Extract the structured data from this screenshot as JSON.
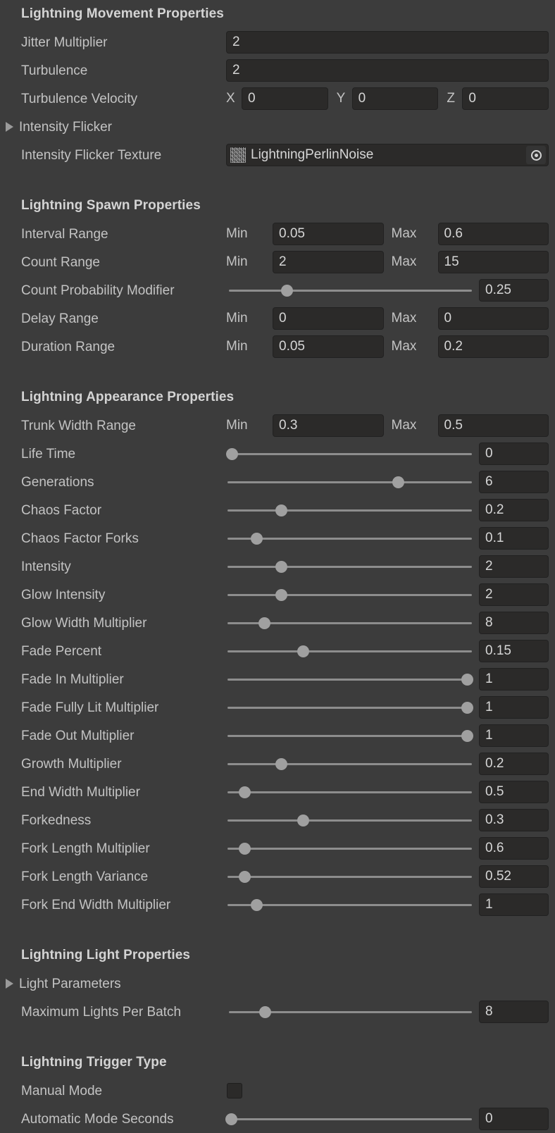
{
  "colors": {
    "background": "#3c3c3c",
    "field_fill": "#2b2a29",
    "field_border": "#212121",
    "label_text": "#c3c3c3",
    "header_text": "#d4d4d4",
    "value_text": "#d6d6d6",
    "slider_track": "#8d8d8d",
    "slider_handle": "#a0a0a0"
  },
  "sections": {
    "movement": {
      "title": "Lightning Movement Properties",
      "jitter_multiplier": {
        "label": "Jitter Multiplier",
        "value": "2"
      },
      "turbulence": {
        "label": "Turbulence",
        "value": "2"
      },
      "turbulence_velocity": {
        "label": "Turbulence Velocity",
        "x_label": "X",
        "x_value": "0",
        "y_label": "Y",
        "y_value": "0",
        "z_label": "Z",
        "z_value": "0"
      },
      "intensity_flicker": {
        "label": "Intensity Flicker",
        "expanded": false
      },
      "intensity_flicker_texture": {
        "label": "Intensity Flicker Texture",
        "value": "LightningPerlinNoise",
        "thumbnail": "noise-texture-thumbnail",
        "picker": "object-picker-icon"
      }
    },
    "spawn": {
      "title": "Lightning Spawn Properties",
      "min_label": "Min",
      "max_label": "Max",
      "rows": [
        {
          "label": "Interval Range",
          "min": "0.05",
          "max": "0.6"
        },
        {
          "label": "Count Range",
          "min": "2",
          "max": "15"
        },
        {
          "label": "Delay Range",
          "min": "0",
          "max": "0"
        },
        {
          "label": "Duration Range",
          "min": "0.05",
          "max": "0.2"
        }
      ],
      "count_probability_modifier": {
        "label": "Count Probability Modifier",
        "value": "0.25",
        "slider_percent": 24
      }
    },
    "appearance": {
      "title": "Lightning Appearance Properties",
      "min_label": "Min",
      "max_label": "Max",
      "trunk_width_range": {
        "label": "Trunk Width Range",
        "min": "0.3",
        "max": "0.5"
      },
      "sliders": [
        {
          "label": "Life Time",
          "value": "0",
          "percent": 2
        },
        {
          "label": "Generations",
          "value": "6",
          "percent": 70
        },
        {
          "label": "Chaos Factor",
          "value": "0.2",
          "percent": 22
        },
        {
          "label": "Chaos Factor Forks",
          "value": "0.1",
          "percent": 12
        },
        {
          "label": "Intensity",
          "value": "2",
          "percent": 22
        },
        {
          "label": "Glow Intensity",
          "value": "2",
          "percent": 22
        },
        {
          "label": "Glow Width Multiplier",
          "value": "8",
          "percent": 15
        },
        {
          "label": "Fade Percent",
          "value": "0.15",
          "percent": 31
        },
        {
          "label": "Fade In Multiplier",
          "value": "1",
          "percent": 98
        },
        {
          "label": "Fade Fully Lit Multiplier",
          "value": "1",
          "percent": 98
        },
        {
          "label": "Fade Out Multiplier",
          "value": "1",
          "percent": 98
        },
        {
          "label": "Growth Multiplier",
          "value": "0.2",
          "percent": 22
        },
        {
          "label": "End Width Multiplier",
          "value": "0.5",
          "percent": 7
        },
        {
          "label": "Forkedness",
          "value": "0.3",
          "percent": 31
        },
        {
          "label": "Fork Length Multiplier",
          "value": "0.6",
          "percent": 7
        },
        {
          "label": "Fork Length Variance",
          "value": "0.52",
          "percent": 7
        },
        {
          "label": "Fork End Width Multiplier",
          "value": "1",
          "percent": 12
        }
      ]
    },
    "light": {
      "title": "Lightning Light Properties",
      "light_parameters": {
        "label": "Light Parameters",
        "expanded": false
      },
      "maximum_lights_per_batch": {
        "label": "Maximum Lights Per Batch",
        "value": "8",
        "slider_percent": 15
      }
    },
    "trigger": {
      "title": "Lightning Trigger Type",
      "manual_mode": {
        "label": "Manual Mode",
        "checked": false
      },
      "automatic_mode_seconds": {
        "label": "Automatic Mode Seconds",
        "value": "0",
        "slider_percent": 1
      }
    }
  }
}
